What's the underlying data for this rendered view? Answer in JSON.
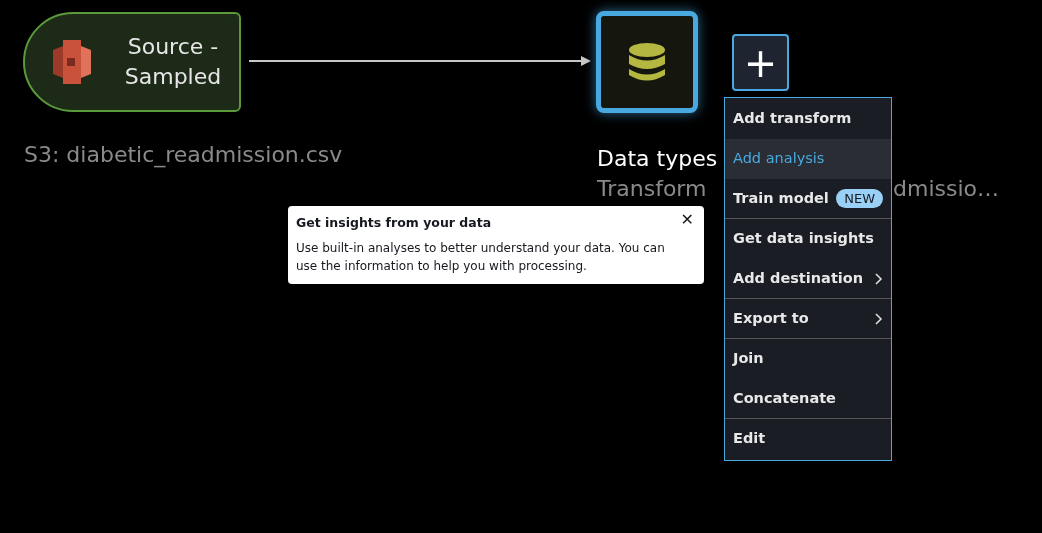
{
  "source_node": {
    "title": "Source - Sampled",
    "subtitle": "S3: diabetic_readmission.csv"
  },
  "transform_node": {
    "selected": true,
    "title": "Data types",
    "subtitle_start": "Transform",
    "subtitle_end": "dmissio…"
  },
  "add_button": {
    "label": "+"
  },
  "tooltip": {
    "title": "Get insights from your data",
    "body": "Use built-in analyses to better understand your data. You can use the information to help you with processing.",
    "close": "✕"
  },
  "menu": [
    {
      "label": "Add transform",
      "selected": false,
      "submenu": false,
      "divider_after": false
    },
    {
      "label": "Add analysis",
      "selected": true,
      "submenu": false,
      "divider_after": false
    },
    {
      "label": "Train model",
      "selected": false,
      "submenu": false,
      "divider_after": true,
      "badge": "NEW"
    },
    {
      "label": "Get data insights",
      "selected": false,
      "submenu": false,
      "divider_after": false
    },
    {
      "label": "Add destination",
      "selected": false,
      "submenu": true,
      "divider_after": true
    },
    {
      "label": "Export to",
      "selected": false,
      "submenu": true,
      "divider_after": true
    },
    {
      "label": "Join",
      "selected": false,
      "submenu": false,
      "divider_after": false
    },
    {
      "label": "Concatenate",
      "selected": false,
      "submenu": false,
      "divider_after": true
    },
    {
      "label": "Edit",
      "selected": false,
      "submenu": false,
      "divider_after": false
    }
  ]
}
